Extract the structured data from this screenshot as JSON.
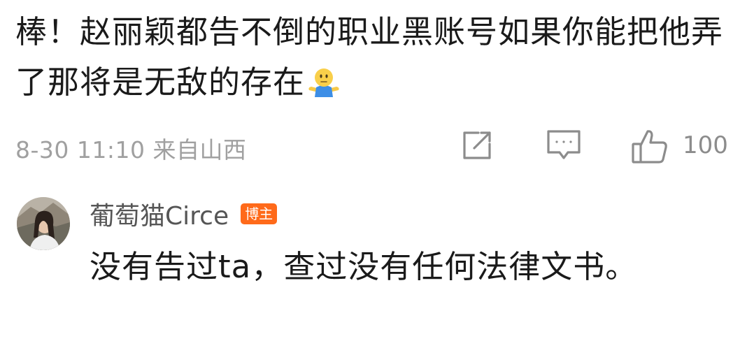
{
  "comment": {
    "text": "棒！赵丽颖都告不倒的职业黑账号如果你能把他弄了那将是无敌的存在",
    "emoji": "shrug-emoji",
    "time": "8-30 11:10",
    "location": "来自山西",
    "likes": "100"
  },
  "reply": {
    "author": "葡萄猫Circe",
    "badge": "博主",
    "text": "没有告过ta，查过没有任何法律文书。"
  },
  "colors": {
    "text": "#1a1a1a",
    "meta": "#a0a0a0",
    "icon": "#8c8c8c",
    "author": "#555555",
    "badge": "#ff6a1a"
  }
}
